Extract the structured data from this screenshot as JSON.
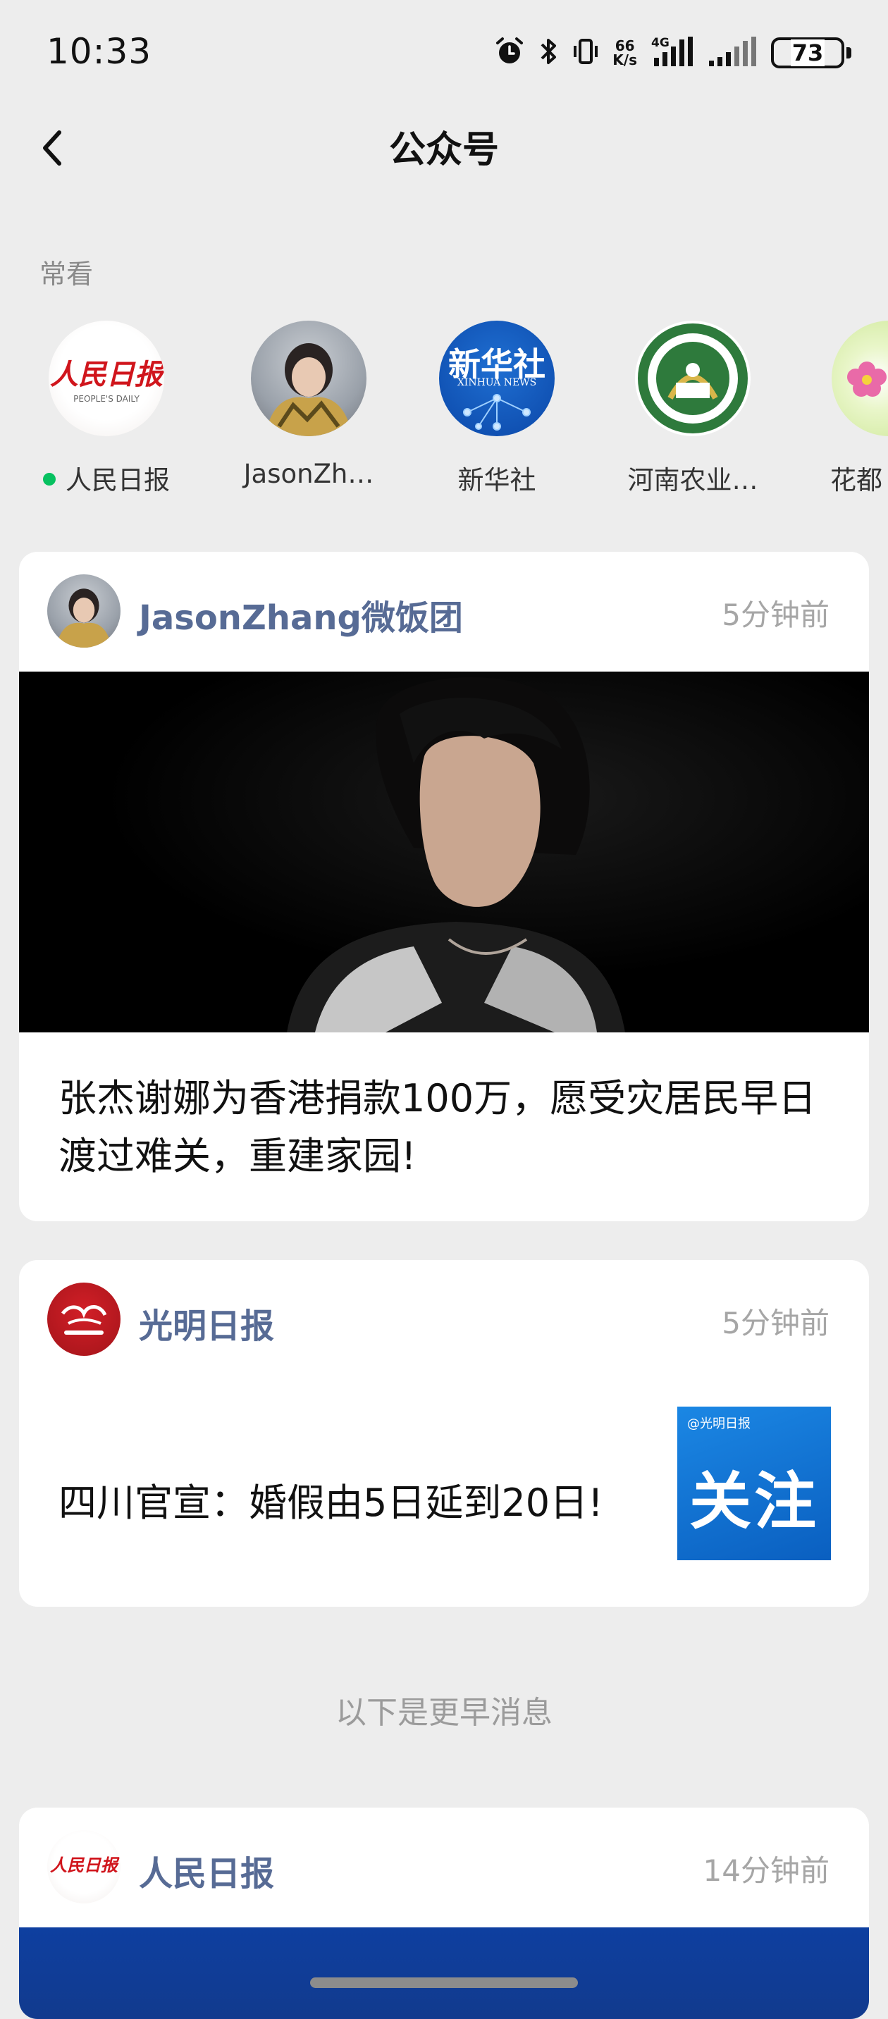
{
  "status_bar": {
    "time": "10:33",
    "network_speed_top": "66",
    "network_speed_bottom": "K/s",
    "network_type": "4G",
    "battery": "73",
    "battery_level": 0.73
  },
  "nav": {
    "title": "公众号"
  },
  "frequent": {
    "label": "常看",
    "items": [
      {
        "name": "人民日报",
        "has_new": true
      },
      {
        "name": "JasonZh…",
        "has_new": false
      },
      {
        "name": "新华社",
        "has_new": false
      },
      {
        "name": "河南农业…",
        "has_new": false
      },
      {
        "name": "花都",
        "has_new": false
      }
    ],
    "logo_text": {
      "renmin": "人民日报",
      "renmin_en": "PEOPLE'S DAILY",
      "xinhua": "新华社",
      "xinhua_en": "XINHUA NEWS"
    }
  },
  "articles": [
    {
      "source": "JasonZhang微饭团",
      "time": "5分钟前",
      "title": "张杰谢娜为香港捐款100万，愿受灾居民早日渡过难关，重建家园!"
    },
    {
      "source": "光明日报",
      "time": "5分钟前",
      "title": "四川官宣：婚假由5日延到20日!",
      "thumb_text": "关注",
      "thumb_brand": "@光明日报"
    },
    {
      "source": "人民日报",
      "time": "14分钟前"
    }
  ],
  "divider_text": "以下是更早消息",
  "colors": {
    "background": "#ededed",
    "source_link": "#576b95",
    "online_dot": "#07c160"
  }
}
